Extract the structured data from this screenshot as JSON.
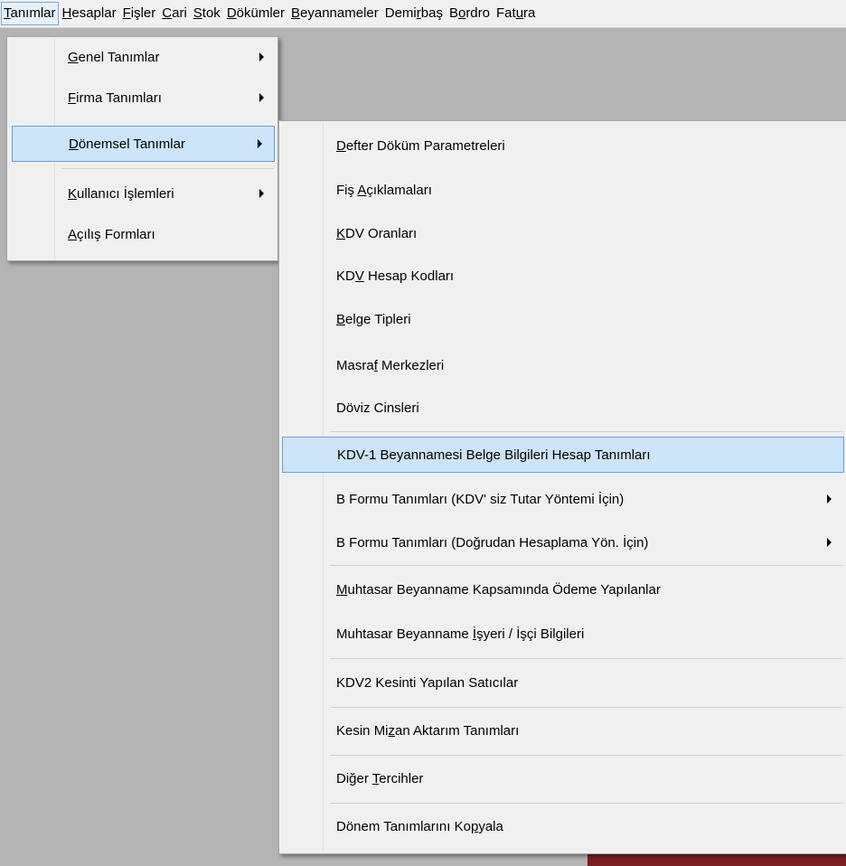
{
  "menubar": [
    {
      "pre": "",
      "u": "T",
      "post": "anımlar"
    },
    {
      "pre": "",
      "u": "H",
      "post": "esaplar"
    },
    {
      "pre": "",
      "u": "F",
      "post": "işler"
    },
    {
      "pre": "",
      "u": "C",
      "post": "ari"
    },
    {
      "pre": "",
      "u": "S",
      "post": "tok"
    },
    {
      "pre": "",
      "u": "D",
      "post": "ökümler"
    },
    {
      "pre": "",
      "u": "B",
      "post": "eyannameler"
    },
    {
      "pre": "Demi",
      "u": "r",
      "post": "baş"
    },
    {
      "pre": "B",
      "u": "o",
      "post": "rdro"
    },
    {
      "pre": "Fat",
      "u": "u",
      "post": "ra"
    }
  ],
  "menu1": [
    {
      "pre": "",
      "u": "G",
      "post": "enel Tanımlar",
      "arrow": true
    },
    {
      "pre": "",
      "u": "F",
      "post": "irma Tanımları",
      "arrow": true
    },
    {
      "pre": "",
      "u": "D",
      "post": "önemsel Tanımlar",
      "arrow": true
    },
    {
      "pre": "",
      "u": "K",
      "post": "ullanıcı İşlemleri",
      "arrow": true
    },
    {
      "pre": "",
      "u": "A",
      "post": "çılış Formları",
      "arrow": false
    }
  ],
  "menu2": [
    {
      "pre": "",
      "u": "D",
      "post": "efter Döküm Parametreleri"
    },
    {
      "pre": "Fiş ",
      "u": "A",
      "post": "çıklamaları"
    },
    {
      "pre": "",
      "u": "K",
      "post": "DV Oranları"
    },
    {
      "pre": "KD",
      "u": "V",
      "post": " Hesap Kodları"
    },
    {
      "pre": "",
      "u": "B",
      "post": "elge Tipleri"
    },
    {
      "pre": "Masra",
      "u": "f",
      "post": " Merkezleri"
    },
    {
      "pre": "Döviz Cinsleri",
      "u": "",
      "post": ""
    },
    {
      "pre": "KDV-1 Beyannamesi Belge Bilgileri Hesap Tanımları",
      "u": "",
      "post": ""
    },
    {
      "pre": "B Formu Tanımları (KDV' siz Tutar Yöntemi İçin)",
      "u": "",
      "post": ""
    },
    {
      "pre": "B Formu Tanımları (Doğrudan Hesaplama Yön. İçin)",
      "u": "",
      "post": ""
    },
    {
      "pre": "",
      "u": "M",
      "post": "uhtasar Beyanname Kapsamında Ödeme Yapılanlar"
    },
    {
      "pre": "Muhtasar Beyanname ",
      "u": "İ",
      "post": "şyeri / İşçi Bilgileri"
    },
    {
      "pre": "KDV2 Kesinti Yapılan Satıcılar",
      "u": "",
      "post": ""
    },
    {
      "pre": "Kesin Mi",
      "u": "z",
      "post": "an Aktarım Tanımları"
    },
    {
      "pre": "Diğer ",
      "u": "T",
      "post": "ercihler"
    },
    {
      "pre": "Dönem Tanımlarını Ko",
      "u": "p",
      "post": "yala"
    }
  ]
}
